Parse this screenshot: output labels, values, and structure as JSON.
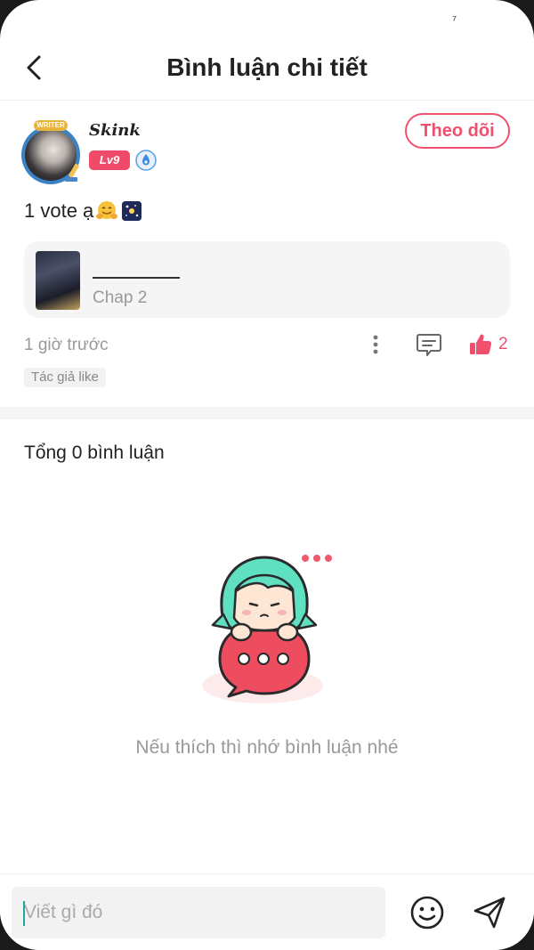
{
  "status_bar": {
    "glyph": "⁷"
  },
  "header": {
    "title": "Bình luận chi tiết",
    "back_icon": "chevron-left-icon"
  },
  "post": {
    "username": "Skink",
    "avatar_badge": "WRITER",
    "level": "Lv9",
    "follow_label": "Theo dõi",
    "text": "1 vote ạ",
    "chapter": {
      "name": "",
      "label": "Chap 2"
    },
    "time": "1 giờ trước",
    "like_count": "2",
    "author_tag": "Tác giả like"
  },
  "comments": {
    "total_label": "Tổng 0 bình luận",
    "empty_message": "Nếu thích thì nhớ bình luận nhé"
  },
  "composer": {
    "placeholder": "Viết gì đó"
  },
  "colors": {
    "accent": "#f0506e",
    "level_badge": "#f04a6a",
    "mascot_hair": "#5fe0c0",
    "mascot_bubble": "#ee4d5f"
  }
}
